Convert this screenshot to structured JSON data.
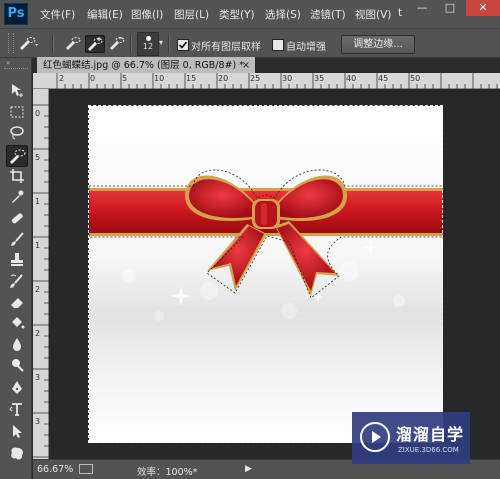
{
  "app": {
    "logo": "Ps"
  },
  "menu": [
    {
      "label": "文件(F)"
    },
    {
      "label": "编辑(E)"
    },
    {
      "label": "图像(I)"
    },
    {
      "label": "图层(L)"
    },
    {
      "label": "类型(Y)"
    },
    {
      "label": "选择(S)"
    },
    {
      "label": "滤镜(T)"
    },
    {
      "label": "视图(V)"
    },
    {
      "label": "t"
    }
  ],
  "window_controls": {
    "minimize": "—",
    "maximize": "□",
    "close": "✕"
  },
  "options_bar": {
    "brush_size": "12",
    "sample_all_layers_label": "对所有图层取样",
    "sample_all_layers_checked": true,
    "auto_enhance_label": "自动增强",
    "auto_enhance_checked": false,
    "refine_edge_label": "调整边缘..."
  },
  "document": {
    "tab_title": "红色蝴蝶结.jpg @ 66.7% (图层 0, RGB/8#) *",
    "tab_close": "×",
    "ruler_top_ticks": [
      "2",
      "0",
      "5",
      "10",
      "15",
      "20",
      "25",
      "30",
      "35",
      "40",
      "45",
      "50"
    ],
    "ruler_left_ticks": [
      "0",
      "5",
      "1",
      "1",
      "2",
      "2",
      "3",
      "3"
    ]
  },
  "status": {
    "zoom": "66.67%",
    "efficiency": "效率：100%*",
    "arrow": "▶"
  },
  "watermark": {
    "title": "溜溜自学",
    "url": "ZIXUE.3D66.COM"
  },
  "colors": {
    "ui_panel": "#535353",
    "canvas_bg": "#282828",
    "ribbon_red": "#c8161d",
    "ribbon_gold": "#e0b15a",
    "watermark_bg": "#303e80"
  }
}
